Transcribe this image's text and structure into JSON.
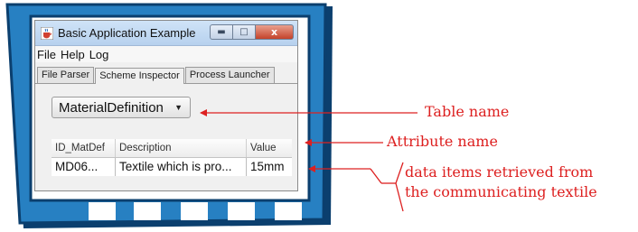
{
  "colors": {
    "frame_fill": "#2780c2",
    "frame_border": "#0b3f6e",
    "annotation": "#dd2020"
  },
  "window": {
    "title": "Basic Application Example",
    "icon": "java-cup-icon",
    "controls": {
      "minimize_icon": "minimize-icon",
      "maximize_icon": "maximize-icon",
      "close_label": "x"
    }
  },
  "menu": {
    "items": [
      {
        "label": "File"
      },
      {
        "label": "Help"
      },
      {
        "label": "Log"
      }
    ]
  },
  "tabs": [
    {
      "label": "File Parser",
      "active": false
    },
    {
      "label": "Scheme Inspector",
      "active": true
    },
    {
      "label": "Process Launcher",
      "active": false
    }
  ],
  "table_select": {
    "value": "MaterialDefinition",
    "arrow_icon": "dropdown-arrow-icon"
  },
  "attribute_table": {
    "columns": [
      "ID_MatDef",
      "Description",
      "Value"
    ],
    "rows": [
      [
        "MD06...",
        "Textile which is pro...",
        "15mm"
      ]
    ]
  },
  "annotations": {
    "table_name": "Table name",
    "attribute_name": "Attribute name",
    "data_items_line1": "data items retrieved from",
    "data_items_line2": "the communicating textile"
  }
}
